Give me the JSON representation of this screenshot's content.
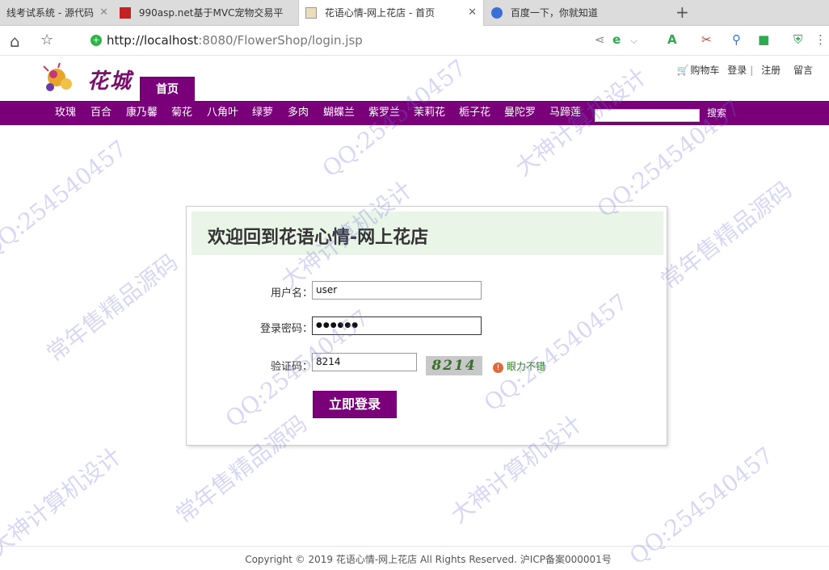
{
  "browser": {
    "tabs": [
      {
        "label": "线考试系统 - 源代码",
        "active": false
      },
      {
        "label": "990asp.net基于MVC宠物交易平",
        "active": false
      },
      {
        "label": "花语心情-网上花店 - 首页",
        "active": true
      },
      {
        "label": "百度一下，你就知道",
        "active": false
      }
    ],
    "new_tab_icon": "plus-icon",
    "close_icon": "close-icon",
    "url_host": "http://localhost",
    "url_rest": ":8080/FlowerShop/login.jsp"
  },
  "header": {
    "logo_text": "花城",
    "home_tab": "首页",
    "cart": "购物车",
    "login": "登录",
    "register": "注册",
    "message": "留言"
  },
  "categories": [
    "玫瑰",
    "百合",
    "康乃馨",
    "菊花",
    "八角叶",
    "绿萝",
    "多肉",
    "蝴蝶兰",
    "紫罗兰",
    "茉莉花",
    "栀子花",
    "曼陀罗",
    "马蹄莲"
  ],
  "search": {
    "button": "搜索",
    "value": ""
  },
  "login": {
    "title": "欢迎回到花语心情-网上花店",
    "username_label": "用户名：",
    "username_value": "user",
    "password_label": "登录密码：",
    "password_value": "●●●●●●",
    "captcha_label": "验证码：",
    "captcha_value": "8214",
    "captcha_image_text": "8214",
    "captcha_hint": "眼力不错",
    "submit": "立即登录"
  },
  "footer": {
    "text": "Copyright © 2019 花语心情-网上花店 All Rights Reserved. 沪ICP备案000001号"
  },
  "watermark": {
    "lines": [
      "QQ:254540457",
      "常年售精品源码",
      "大神计算机设计"
    ]
  },
  "colors": {
    "brand": "#7a0079",
    "panel_header": "#e9f5e7"
  }
}
